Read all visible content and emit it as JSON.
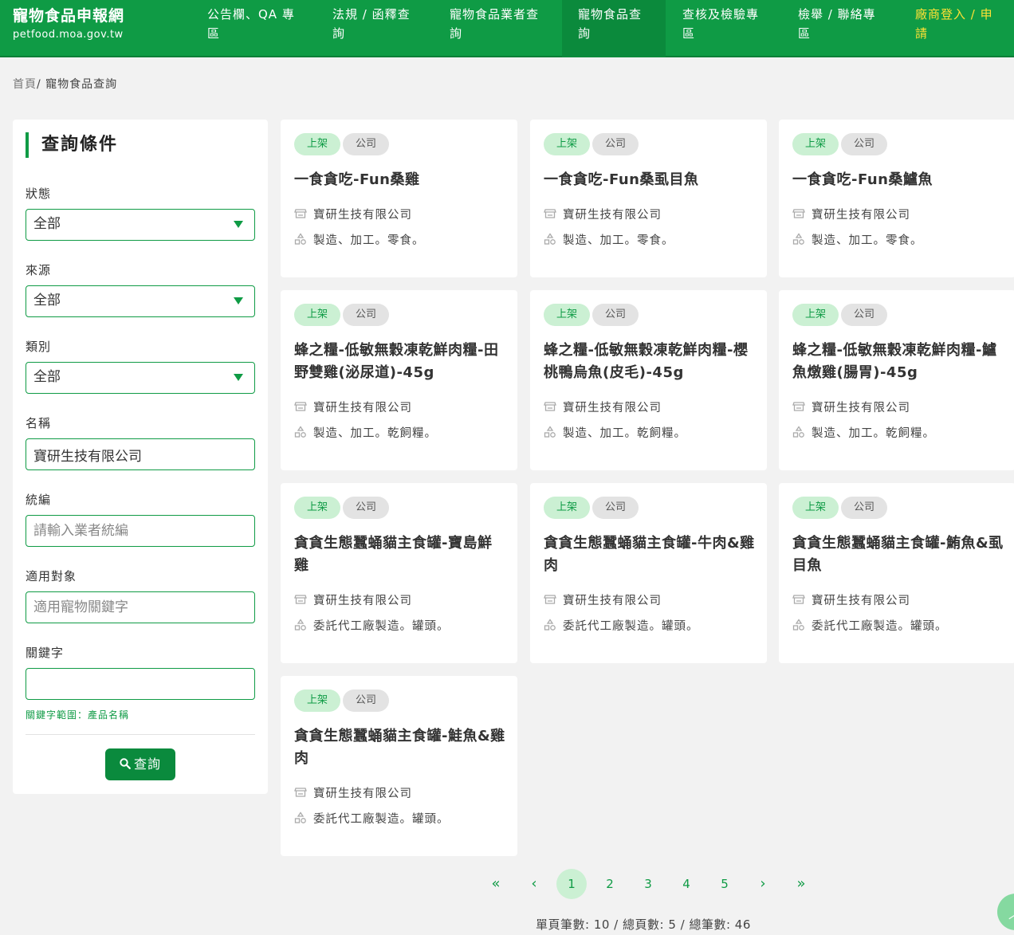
{
  "header": {
    "title": "寵物食品申報網",
    "domain": "petfood.moa.gov.tw",
    "nav": [
      {
        "line1": "公告欄、QA 專",
        "line2": "區"
      },
      {
        "line1": "法規 / 函釋查",
        "line2": "詢"
      },
      {
        "line1": "寵物食品業者查",
        "line2": "詢"
      },
      {
        "line1": "寵物食品查",
        "line2": "詢"
      },
      {
        "line1": "查核及檢驗專",
        "line2": "區"
      },
      {
        "line1": "檢舉 / 聯絡專",
        "line2": "區"
      },
      {
        "line1": "廠商登入 / 申",
        "line2": "請"
      }
    ]
  },
  "breadcrumb": {
    "home": "首頁",
    "separator": "/",
    "current": "寵物食品查詢"
  },
  "sidebar": {
    "title": "查詢條件",
    "status": {
      "label": "狀態",
      "value": "全部"
    },
    "source": {
      "label": "來源",
      "value": "全部"
    },
    "category": {
      "label": "類別",
      "value": "全部"
    },
    "name": {
      "label": "名稱",
      "value": "寶研生技有限公司"
    },
    "tax_id": {
      "label": "統編",
      "placeholder": "請輸入業者統編"
    },
    "target": {
      "label": "適用對象",
      "placeholder": "適用寵物關鍵字"
    },
    "keyword": {
      "label": "關鍵字",
      "value": ""
    },
    "hint": "關鍵字範圍：產品名稱",
    "search_label": "查詢"
  },
  "cards": [
    {
      "status": "上架",
      "type": "公司",
      "title": "一食貪吃-Fun桑雞",
      "company": "寶研生技有限公司",
      "desc": "製造、加工。零食。"
    },
    {
      "status": "上架",
      "type": "公司",
      "title": "一食貪吃-Fun桑虱目魚",
      "company": "寶研生技有限公司",
      "desc": "製造、加工。零食。"
    },
    {
      "status": "上架",
      "type": "公司",
      "title": "一食貪吃-Fun桑鱸魚",
      "company": "寶研生技有限公司",
      "desc": "製造、加工。零食。"
    },
    {
      "status": "上架",
      "type": "公司",
      "title": "蜂之糧-低敏無穀凍乾鮮肉糧-田野雙雞(泌尿道)-45g",
      "company": "寶研生技有限公司",
      "desc": "製造、加工。乾飼糧。"
    },
    {
      "status": "上架",
      "type": "公司",
      "title": "蜂之糧-低敏無穀凍乾鮮肉糧-櫻桃鴨烏魚(皮毛)-45g",
      "company": "寶研生技有限公司",
      "desc": "製造、加工。乾飼糧。"
    },
    {
      "status": "上架",
      "type": "公司",
      "title": "蜂之糧-低敏無穀凍乾鮮肉糧-鱸魚燉雞(腸胃)-45g",
      "company": "寶研生技有限公司",
      "desc": "製造、加工。乾飼糧。"
    },
    {
      "status": "上架",
      "type": "公司",
      "title": "貪貪生態蠶蛹貓主食罐-寶島鮮雞",
      "company": "寶研生技有限公司",
      "desc": "委託代工廠製造。罐頭。"
    },
    {
      "status": "上架",
      "type": "公司",
      "title": "貪貪生態蠶蛹貓主食罐-牛肉&雞肉",
      "company": "寶研生技有限公司",
      "desc": "委託代工廠製造。罐頭。"
    },
    {
      "status": "上架",
      "type": "公司",
      "title": "貪貪生態蠶蛹貓主食罐-鮪魚&虱目魚",
      "company": "寶研生技有限公司",
      "desc": "委託代工廠製造。罐頭。"
    },
    {
      "status": "上架",
      "type": "公司",
      "title": "貪貪生態蠶蛹貓主食罐-鮭魚&雞肉",
      "company": "寶研生技有限公司",
      "desc": "委託代工廠製造。罐頭。"
    }
  ],
  "pagination": {
    "first": "«",
    "prev": "‹",
    "pages": [
      "1",
      "2",
      "3",
      "4",
      "5"
    ],
    "current": "1",
    "next": "›",
    "last": "»",
    "summary": "單頁筆數: 10 / 總頁數: 5 / 總筆數: 46"
  },
  "icons": {
    "company": "store-icon",
    "desc": "shapes-icon",
    "search": "search-icon",
    "back_to_top": "chevron-up-icon"
  },
  "colors": {
    "brand": "#0f9b45",
    "tag_status_bg": "#cbf0d3",
    "tag_type_bg": "#e3e3e3",
    "login": "#ffe135"
  }
}
